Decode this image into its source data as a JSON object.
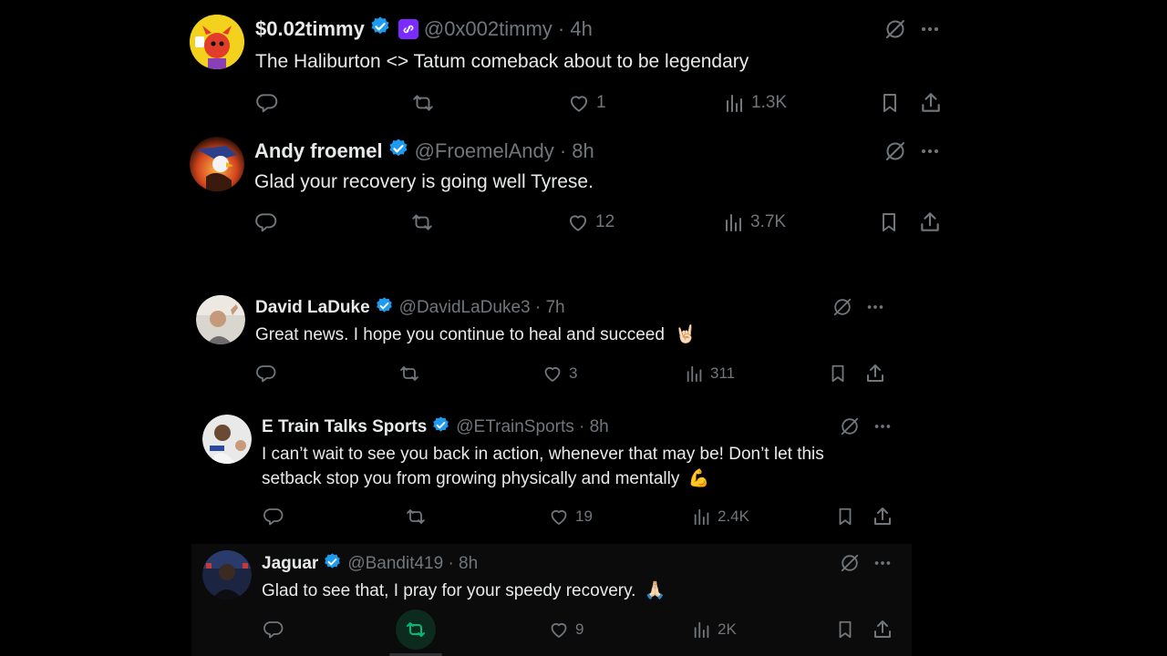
{
  "colors": {
    "background": "#000000",
    "text": "#e7e9ea",
    "muted": "#71767b",
    "verified": "#1d9bf0",
    "retweet_active": "#00ba7c"
  },
  "tweets": [
    {
      "name": "$0.02timmy",
      "handle_meta": "@0x002timmy · 4h",
      "text": "The Haliburton <> Tatum comeback about to be legendary",
      "replies": "",
      "retweets": "",
      "likes": "1",
      "views": "1.3K"
    },
    {
      "name": "Andy froemel",
      "handle_meta": "@FroemelAndy · 8h",
      "text": "Glad your recovery is going well Tyrese.",
      "replies": "",
      "retweets": "",
      "likes": "12",
      "views": "3.7K"
    },
    {
      "name": "David LaDuke",
      "handle_meta": "@DavidLaDuke3 · 7h",
      "text": "Great news. I hope you continue to heal and succeed",
      "emoji": "🤘🏻",
      "replies": "",
      "retweets": "",
      "likes": "3",
      "views": "311"
    },
    {
      "name": "E Train Talks Sports",
      "handle_meta": "@ETrainSports · 8h",
      "text_line1": "I can’t wait to see you back in action, whenever that may be! Don’t let this",
      "text_line2": "setback stop you from growing physically and mentally",
      "emoji": "💪",
      "replies": "",
      "retweets": "",
      "likes": "19",
      "views": "2.4K"
    },
    {
      "name": "Jaguar",
      "handle_meta": "@Bandit419 · 8h",
      "text": "Glad to see that, I pray for your speedy recovery.",
      "emoji": "🙏🏻",
      "replies": "",
      "retweets": "",
      "likes": "9",
      "views": "2K"
    }
  ]
}
